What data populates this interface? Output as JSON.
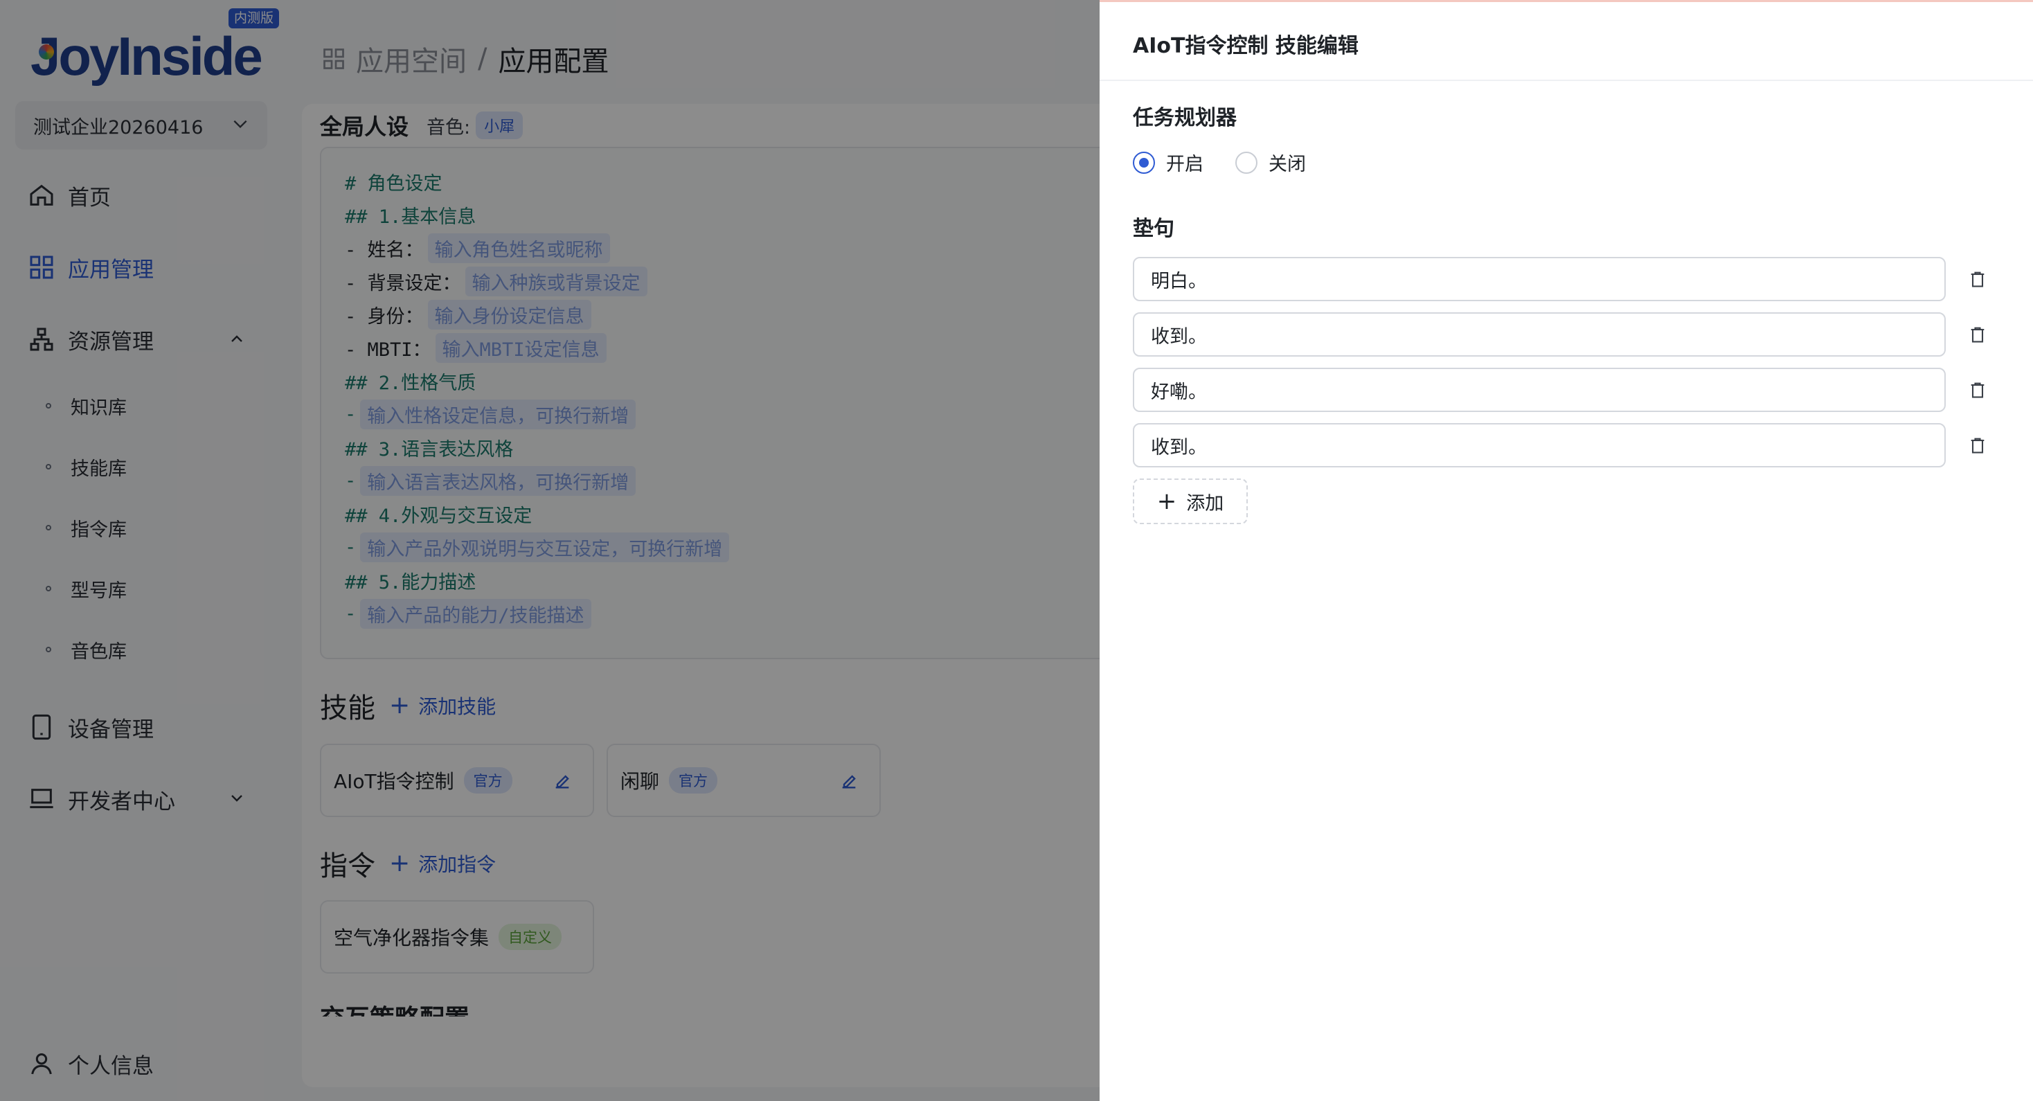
{
  "sidebar": {
    "logo_text": "JoyInside",
    "beta_badge": "内测版",
    "org_selector": "测试企业20260416",
    "nav": {
      "home": "首页",
      "app_management": "应用管理",
      "resource_management": "资源管理",
      "device_management": "设备管理",
      "developer_center": "开发者中心",
      "profile": "个人信息"
    },
    "resource_sub": [
      "知识库",
      "技能库",
      "指令库",
      "型号库",
      "音色库"
    ]
  },
  "main": {
    "breadcrumb": {
      "parent": "应用空间",
      "separator": "/",
      "current": "应用配置"
    },
    "persona": {
      "title": "全局人设",
      "voice_label": "音色:",
      "voice_value": "小犀",
      "lines": [
        {
          "prefix": "# 角色设定",
          "placeholder": ""
        },
        {
          "prefix": "## 1.基本信息",
          "placeholder": ""
        },
        {
          "prefix": "- 姓名：",
          "placeholder": "输入角色姓名或昵称"
        },
        {
          "prefix": "- 背景设定：",
          "placeholder": "输入种族或背景设定"
        },
        {
          "prefix": "- 身份：",
          "placeholder": "输入身份设定信息"
        },
        {
          "prefix": "- MBTI：",
          "placeholder": "输入MBTI设定信息"
        },
        {
          "prefix": "## 2.性格气质",
          "placeholder": ""
        },
        {
          "prefix": "-",
          "placeholder": "输入性格设定信息，可换行新增"
        },
        {
          "prefix": "## 3.语言表达风格",
          "placeholder": ""
        },
        {
          "prefix": "-",
          "placeholder": "输入语言表达风格，可换行新增"
        },
        {
          "prefix": "## 4.外观与交互设定",
          "placeholder": ""
        },
        {
          "prefix": "-",
          "placeholder": "输入产品外观说明与交互设定，可换行新增"
        },
        {
          "prefix": "## 5.能力描述",
          "placeholder": ""
        },
        {
          "prefix": "-",
          "placeholder": "输入产品的能力/技能描述"
        }
      ]
    },
    "skills": {
      "title": "技能",
      "add_label": "添加技能",
      "items": [
        {
          "name": "AIoT指令控制",
          "tag": "官方"
        },
        {
          "name": "闲聊",
          "tag": "官方"
        }
      ]
    },
    "commands": {
      "title": "指令",
      "add_label": "添加指令",
      "items": [
        {
          "name": "空气净化器指令集",
          "tag": "自定义"
        }
      ]
    },
    "interaction_title": "交互策略配置"
  },
  "drawer": {
    "title": "AIoT指令控制 技能编辑",
    "planner_label": "任务规划器",
    "planner_options": {
      "on": "开启",
      "off": "关闭"
    },
    "planner_value": "开启",
    "phrases_label": "垫句",
    "phrases": [
      "明白。",
      "收到。",
      "好嘞。",
      "收到。"
    ],
    "add_label": "添加"
  },
  "colors": {
    "accent": "#2f5bd3",
    "heading_green": "#1a7a6c",
    "overlay": "rgba(0,0,0,0.45)"
  }
}
